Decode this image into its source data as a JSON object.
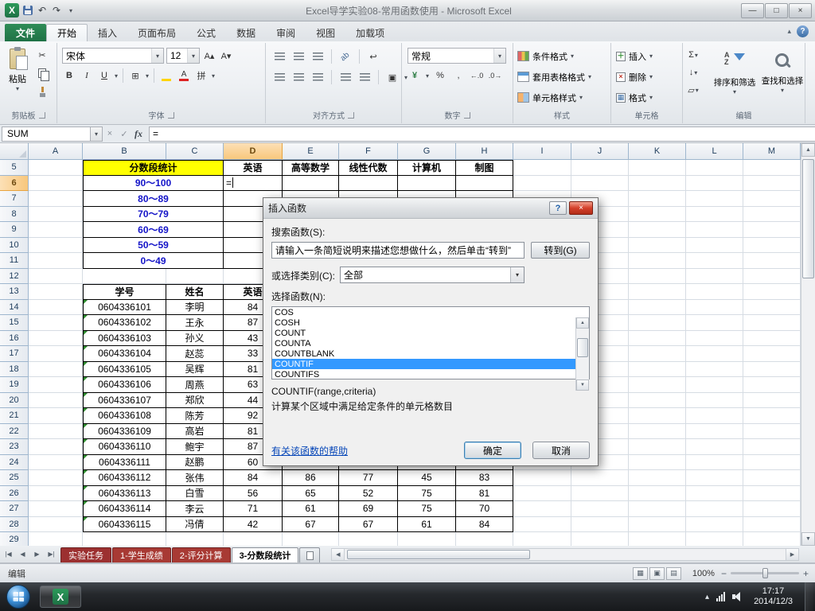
{
  "titlebar": {
    "title": "Excel导学实验08-常用函数使用  -  Microsoft Excel"
  },
  "icons": {
    "excel": "X",
    "undo": "↶",
    "redo": "↷",
    "dropdown": "▾",
    "up": "▴",
    "minimize": "—",
    "restore": "□",
    "close": "×",
    "ribbon_collapse": "▴",
    "help": "?",
    "scissors": "✂",
    "bold": "B",
    "italic": "I",
    "underline": "U",
    "borders": "⊞",
    "phonetic": "拼",
    "grow_font": "A▴",
    "shrink_font": "A▾",
    "orientation": "ab",
    "wrap": "↩",
    "merge": "▣",
    "currency": "¥",
    "percent": "%",
    "comma": ",",
    "inc_decimal": "←.0",
    "dec_decimal": ".0→",
    "sigma": "Σ",
    "fill_down": "↓",
    "clear": "▱",
    "insert_cells": "＋",
    "delete_cells": "×",
    "format_cells": "▦",
    "check": "✓",
    "cross": "×",
    "fx": "fx",
    "nav_first": "|◀",
    "nav_prev": "◀",
    "nav_next": "▶",
    "nav_last": "▶|",
    "scroll_up": "▲",
    "scroll_down": "▼",
    "scroll_left": "◀",
    "scroll_right": "▶",
    "view_normal": "▦",
    "view_layout": "▣",
    "view_break": "▤",
    "zoom_out": "−",
    "zoom_in": "+",
    "tray_up": "▴",
    "sort_az": "A\nZ"
  },
  "ribbon": {
    "file_tab": "文件",
    "tabs": [
      "开始",
      "插入",
      "页面布局",
      "公式",
      "数据",
      "审阅",
      "视图",
      "加载项"
    ],
    "active_tab": "开始",
    "groups": [
      "剪贴板",
      "字体",
      "对齐方式",
      "数字",
      "样式",
      "单元格",
      "编辑"
    ],
    "clipboard": {
      "paste": "粘贴"
    },
    "font": {
      "name": "宋体",
      "size": "12"
    },
    "number": {
      "format": "常规"
    },
    "styles": {
      "conditional": "条件格式",
      "table": "套用表格格式",
      "cell": "单元格样式"
    },
    "cells": {
      "insert": "插入",
      "delete": "删除",
      "format": "格式"
    },
    "editing": {
      "sort": "排序和筛选",
      "find": "查找和选择"
    }
  },
  "formula_bar": {
    "name_box": "SUM",
    "formula": "="
  },
  "grid": {
    "columns": [
      "A",
      "B",
      "C",
      "D",
      "E",
      "F",
      "G",
      "H",
      "I",
      "J",
      "K",
      "L",
      "M"
    ],
    "first_row": 5,
    "last_row": 29,
    "active_column": "D",
    "active_row": 6
  },
  "sheet": {
    "stats": {
      "title": "分数段统计",
      "subjects": [
        "英语",
        "高等数学",
        "线性代数",
        "计算机",
        "制图"
      ],
      "ranges": [
        "90～100",
        "80～89",
        "70～79",
        "60～69",
        "50～59",
        "0～49"
      ],
      "editing_value": "="
    },
    "students": {
      "headers": [
        "学号",
        "姓名",
        "英语"
      ],
      "rows": [
        {
          "id": "0604336101",
          "name": "李明",
          "scores": [
            "84",
            "",
            "",
            "",
            ""
          ]
        },
        {
          "id": "0604336102",
          "name": "王永",
          "scores": [
            "87",
            "",
            "",
            "",
            ""
          ]
        },
        {
          "id": "0604336103",
          "name": "孙义",
          "scores": [
            "43",
            "",
            "",
            "",
            ""
          ]
        },
        {
          "id": "0604336104",
          "name": "赵蕊",
          "scores": [
            "33",
            "",
            "",
            "",
            ""
          ]
        },
        {
          "id": "0604336105",
          "name": "吴辉",
          "scores": [
            "81",
            "",
            "",
            "",
            ""
          ]
        },
        {
          "id": "0604336106",
          "name": "周燕",
          "scores": [
            "63",
            "",
            "",
            "",
            ""
          ]
        },
        {
          "id": "0604336107",
          "name": "郑欣",
          "scores": [
            "44",
            "",
            "",
            "",
            ""
          ]
        },
        {
          "id": "0604336108",
          "name": "陈芳",
          "scores": [
            "92",
            "",
            "",
            "",
            ""
          ]
        },
        {
          "id": "0604336109",
          "name": "高岩",
          "scores": [
            "81",
            "",
            "",
            "",
            ""
          ]
        },
        {
          "id": "0604336110",
          "name": "鲍宇",
          "scores": [
            "87",
            "",
            "",
            "",
            ""
          ]
        },
        {
          "id": "0604336111",
          "name": "赵鹏",
          "scores": [
            "60",
            "",
            "",
            "",
            ""
          ]
        },
        {
          "id": "0604336112",
          "name": "张伟",
          "scores": [
            "84",
            "86",
            "77",
            "45",
            "83"
          ]
        },
        {
          "id": "0604336113",
          "name": "白雪",
          "scores": [
            "56",
            "65",
            "52",
            "75",
            "81"
          ]
        },
        {
          "id": "0604336114",
          "name": "李云",
          "scores": [
            "71",
            "61",
            "69",
            "75",
            "70"
          ]
        },
        {
          "id": "0604336115",
          "name": "冯倩",
          "scores": [
            "42",
            "67",
            "67",
            "61",
            "84"
          ]
        }
      ]
    }
  },
  "dialog": {
    "title": "插入函数",
    "search_label": "搜索函数(S):",
    "search_text": "请输入一条简短说明来描述您想做什么，然后单击“转到”",
    "go_button": "转到(G)",
    "category_label": "或选择类别(C):",
    "category_value": "全部",
    "select_label": "选择函数(N):",
    "functions": [
      "COS",
      "COSH",
      "COUNT",
      "COUNTA",
      "COUNTBLANK",
      "COUNTIF",
      "COUNTIFS"
    ],
    "selected_function": "COUNTIF",
    "signature": "COUNTIF(range,criteria)",
    "description": "计算某个区域中满足给定条件的单元格数目",
    "help_link": "有关该函数的帮助",
    "ok": "确定",
    "cancel": "取消"
  },
  "sheet_tabs": {
    "tabs": [
      {
        "label": "实验任务",
        "color": "#9C3030",
        "text_color": "#FFFFFF",
        "active": false
      },
      {
        "label": "1-学生成绩",
        "color": "#A83A34",
        "text_color": "#FFFFFF",
        "active": false
      },
      {
        "label": "2-评分计算",
        "color": "#A83A34",
        "text_color": "#FFFFFF",
        "active": false
      },
      {
        "label": "3-分数段统计",
        "color": "#FFFFFF",
        "text_color": "#000000",
        "active": true
      }
    ]
  },
  "status_bar": {
    "mode": "编辑",
    "zoom": "100%"
  },
  "taskbar": {
    "time": "17:17",
    "date": "2014/12/3"
  }
}
